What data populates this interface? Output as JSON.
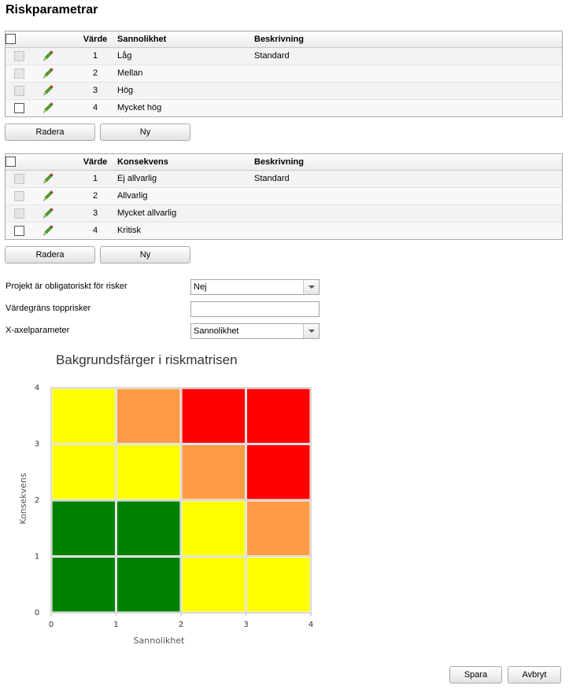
{
  "page": {
    "title": "Riskparametrar"
  },
  "likelihood_table": {
    "headers": {
      "value": "Värde",
      "name": "Sannolikhet",
      "description": "Beskrivning"
    },
    "rows": [
      {
        "value": "1",
        "name": "Låg",
        "description": "Standard",
        "checkbox_enabled": false
      },
      {
        "value": "2",
        "name": "Mellan",
        "description": "",
        "checkbox_enabled": false
      },
      {
        "value": "3",
        "name": "Hög",
        "description": "",
        "checkbox_enabled": false
      },
      {
        "value": "4",
        "name": "Mycket hög",
        "description": "",
        "checkbox_enabled": true
      }
    ],
    "delete_label": "Radera",
    "new_label": "Ny"
  },
  "consequence_table": {
    "headers": {
      "value": "Värde",
      "name": "Konsekvens",
      "description": "Beskrivning"
    },
    "rows": [
      {
        "value": "1",
        "name": "Ej allvarlig",
        "description": "Standard",
        "checkbox_enabled": false
      },
      {
        "value": "2",
        "name": "Allvarlig",
        "description": "",
        "checkbox_enabled": false
      },
      {
        "value": "3",
        "name": "Mycket allvarlig",
        "description": "",
        "checkbox_enabled": false
      },
      {
        "value": "4",
        "name": "Kritisk",
        "description": "",
        "checkbox_enabled": true
      }
    ],
    "delete_label": "Radera",
    "new_label": "Ny"
  },
  "settings": {
    "project_mandatory_label": "Projekt är obligatoriskt för risker",
    "project_mandatory_value": "Nej",
    "top_risk_threshold_label": "Värdegräns topprisker",
    "top_risk_threshold_value": "",
    "x_axis_label": "X-axelparameter",
    "x_axis_value": "Sannolikhet"
  },
  "footer": {
    "save_label": "Spara",
    "cancel_label": "Avbryt"
  },
  "colors": {
    "green": "#008000",
    "yellow": "#ffff00",
    "orange": "#ff9c45",
    "red": "#ff0000",
    "cell_border": "#d8d8d8"
  },
  "chart_data": {
    "type": "heatmap",
    "title": "Bakgrundsfärger i riskmatrisen",
    "xlabel": "Sannolikhet",
    "ylabel": "Konsekvens",
    "xlim": [
      0,
      4
    ],
    "ylim": [
      0,
      4
    ],
    "x_ticks": [
      "0",
      "1",
      "2",
      "3",
      "4"
    ],
    "y_ticks": [
      "0",
      "1",
      "2",
      "3",
      "4"
    ],
    "grid": false,
    "cells_by_row_from_bottom": [
      [
        "green",
        "green",
        "yellow",
        "yellow"
      ],
      [
        "green",
        "green",
        "yellow",
        "orange"
      ],
      [
        "yellow",
        "yellow",
        "orange",
        "red"
      ],
      [
        "yellow",
        "orange",
        "red",
        "red"
      ]
    ]
  }
}
